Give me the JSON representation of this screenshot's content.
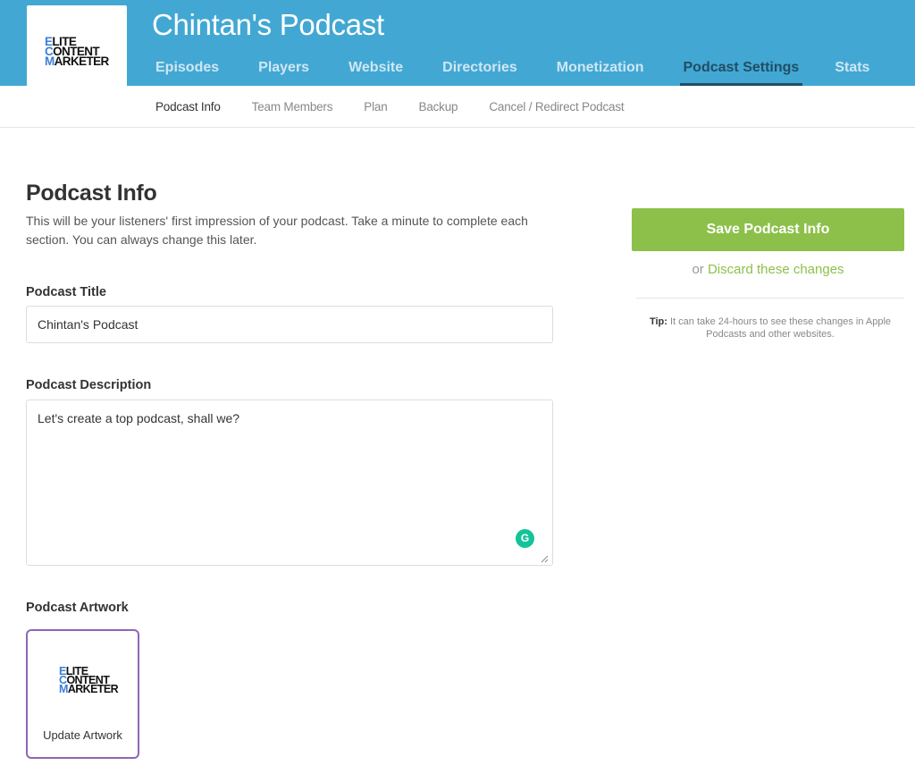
{
  "header": {
    "logo": {
      "line1": "ELITE",
      "line2": "CONTENT",
      "line3": "MARKETER"
    },
    "title": "Chintan's Podcast"
  },
  "nav": [
    {
      "label": "Episodes"
    },
    {
      "label": "Players"
    },
    {
      "label": "Website"
    },
    {
      "label": "Directories"
    },
    {
      "label": "Monetization"
    },
    {
      "label": "Podcast Settings",
      "active": true
    },
    {
      "label": "Stats"
    }
  ],
  "subnav": [
    {
      "label": "Podcast Info",
      "active": true
    },
    {
      "label": "Team Members"
    },
    {
      "label": "Plan"
    },
    {
      "label": "Backup"
    },
    {
      "label": "Cancel / Redirect Podcast"
    }
  ],
  "main": {
    "heading": "Podcast Info",
    "intro": "This will be your listeners' first impression of your podcast. Take a minute to complete each section. You can always change this later.",
    "title_field": {
      "label": "Podcast Title",
      "value": "Chintan's Podcast"
    },
    "description_field": {
      "label": "Podcast Description",
      "value": "Let's create a top podcast, shall we?"
    },
    "artwork": {
      "label": "Podcast Artwork",
      "button_label": "Update Artwork"
    }
  },
  "sidebar": {
    "save_label": "Save Podcast Info",
    "or_text": "or",
    "discard_label": "Discard these changes",
    "tip_label": "Tip:",
    "tip_text": "It can take 24-hours to see these changes in Apple Podcasts and other websites."
  },
  "colors": {
    "header_bg": "#42a8d3",
    "nav_active": "#214d66",
    "accent_green": "#8dc04a",
    "artwork_border": "#8e66b6",
    "grammarly": "#15c39a"
  },
  "icons": {
    "grammarly": "grammarly-icon",
    "resize": "resize-handle-icon"
  }
}
